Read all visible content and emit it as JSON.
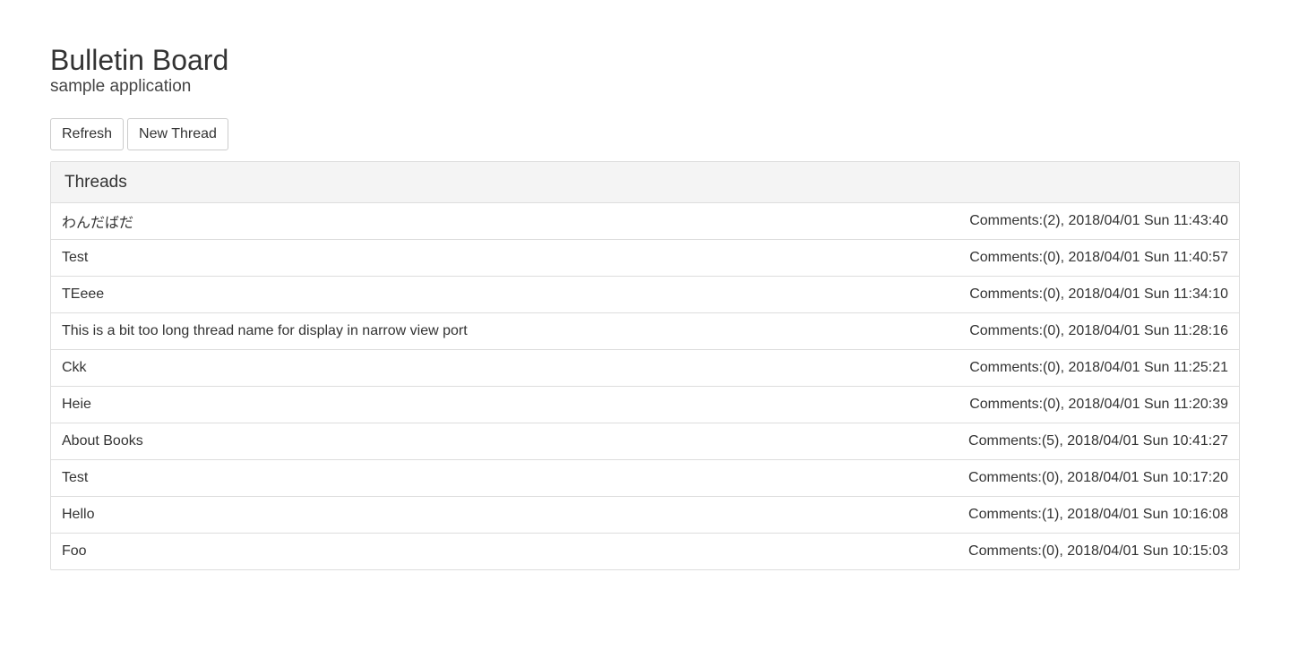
{
  "header": {
    "title": "Bulletin Board",
    "subtitle": "sample application"
  },
  "toolbar": {
    "refresh_label": "Refresh",
    "new_thread_label": "New Thread"
  },
  "panel": {
    "heading": "Threads"
  },
  "threads": [
    {
      "title": "わんだばだ",
      "meta": "Comments:(2), 2018/04/01 Sun 11:43:40"
    },
    {
      "title": "Test",
      "meta": "Comments:(0), 2018/04/01 Sun 11:40:57"
    },
    {
      "title": "TEeee",
      "meta": "Comments:(0), 2018/04/01 Sun 11:34:10"
    },
    {
      "title": "This is a bit too long thread name for display in narrow view port",
      "meta": "Comments:(0), 2018/04/01 Sun 11:28:16"
    },
    {
      "title": "Ckk",
      "meta": "Comments:(0), 2018/04/01 Sun 11:25:21"
    },
    {
      "title": "Heie",
      "meta": "Comments:(0), 2018/04/01 Sun 11:20:39"
    },
    {
      "title": "About Books",
      "meta": "Comments:(5), 2018/04/01 Sun 10:41:27"
    },
    {
      "title": "Test",
      "meta": "Comments:(0), 2018/04/01 Sun 10:17:20"
    },
    {
      "title": "Hello",
      "meta": "Comments:(1), 2018/04/01 Sun 10:16:08"
    },
    {
      "title": "Foo",
      "meta": "Comments:(0), 2018/04/01 Sun 10:15:03"
    }
  ]
}
